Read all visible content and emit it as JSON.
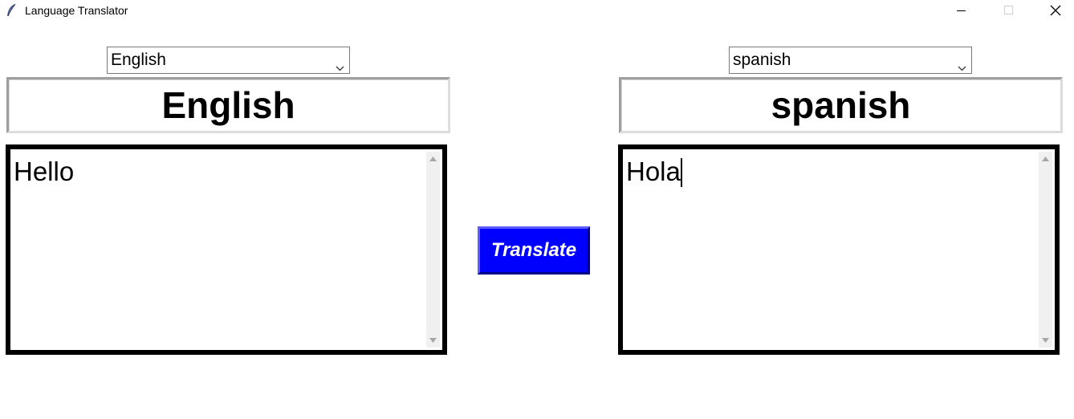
{
  "window": {
    "title": "Language Translator",
    "controls": [
      "minimize",
      "maximize",
      "close"
    ]
  },
  "source": {
    "selected_language": "English",
    "label": "English",
    "text": "Hello"
  },
  "target": {
    "selected_language": "spanish",
    "label": "spanish",
    "text": "Hola"
  },
  "translate_button": {
    "label": "Translate",
    "color": "#0000ff"
  }
}
